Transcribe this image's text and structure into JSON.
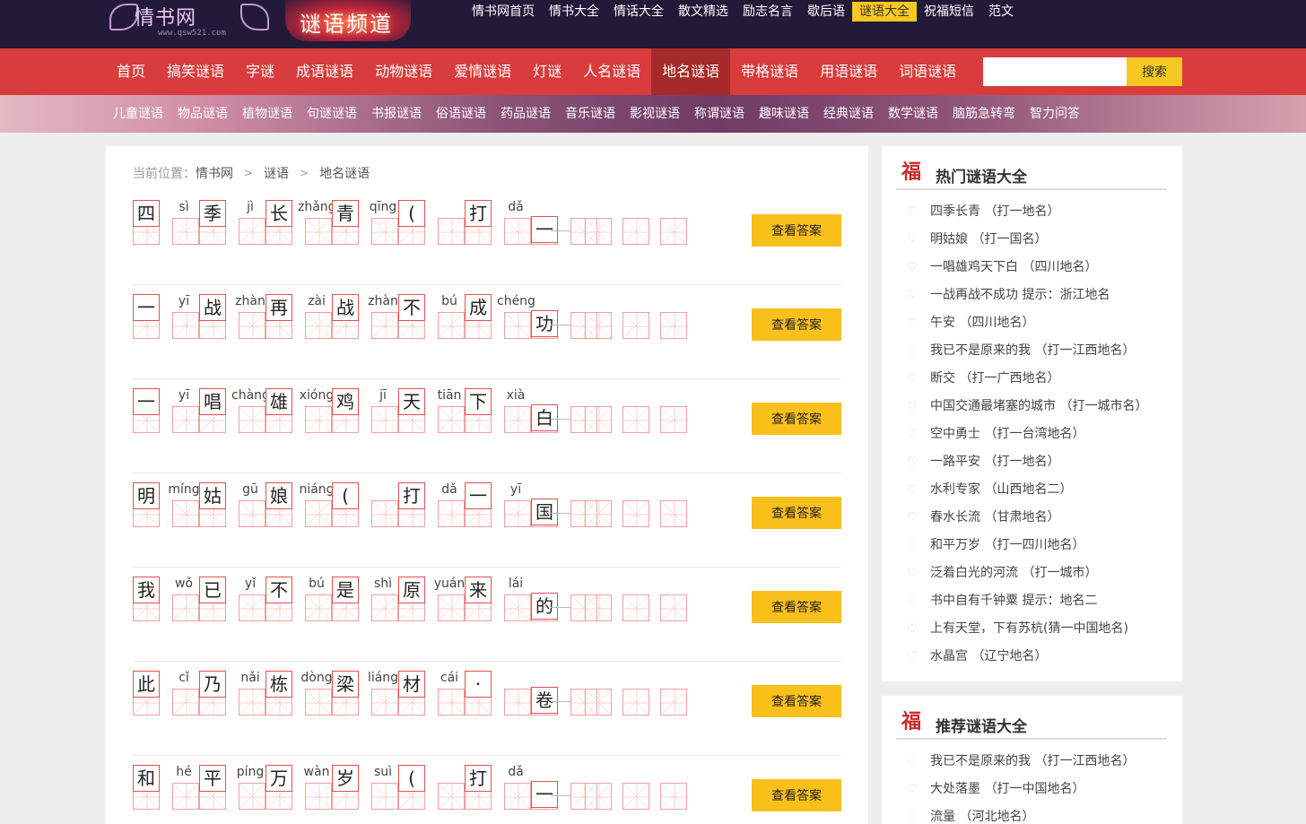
{
  "header": {
    "logo_text": "情书网",
    "logo_url": "www.qsw521.com",
    "channel": "谜语频道",
    "top_nav": [
      {
        "label": "情书网首页",
        "active": false
      },
      {
        "label": "情书大全",
        "active": false
      },
      {
        "label": "情话大全",
        "active": false
      },
      {
        "label": "散文精选",
        "active": false
      },
      {
        "label": "励志名言",
        "active": false
      },
      {
        "label": "歇后语",
        "active": false
      },
      {
        "label": "谜语大全",
        "active": true
      },
      {
        "label": "祝福短信",
        "active": false
      },
      {
        "label": "范文",
        "active": false
      }
    ]
  },
  "main_nav": [
    {
      "label": "首页",
      "active": false
    },
    {
      "label": "搞笑谜语",
      "active": false
    },
    {
      "label": "字谜",
      "active": false
    },
    {
      "label": "成语谜语",
      "active": false
    },
    {
      "label": "动物谜语",
      "active": false
    },
    {
      "label": "爱情谜语",
      "active": false
    },
    {
      "label": "灯谜",
      "active": false
    },
    {
      "label": "人名谜语",
      "active": false
    },
    {
      "label": "地名谜语",
      "active": true
    },
    {
      "label": "带格谜语",
      "active": false
    },
    {
      "label": "用语谜语",
      "active": false
    },
    {
      "label": "词语谜语",
      "active": false
    }
  ],
  "search": {
    "value": "",
    "placeholder": "",
    "button": "搜索"
  },
  "sub_nav": [
    "儿童谜语",
    "物品谜语",
    "植物谜语",
    "句谜谜语",
    "书报谜语",
    "俗语谜语",
    "药品谜语",
    "音乐谜语",
    "影视谜语",
    "称谓谜语",
    "趣味谜语",
    "经典谜语",
    "数学谜语",
    "脑筋急转弯",
    "智力问答"
  ],
  "breadcrumb": {
    "prefix": "当前位置：",
    "items": [
      "情书网",
      "谜语",
      "地名谜语"
    ]
  },
  "answer_button": "查看答案",
  "riddles": [
    {
      "chars": [
        {
          "c": "四",
          "p": "sì"
        },
        {
          "c": "季",
          "p": "jì"
        },
        {
          "c": "长",
          "p": "zhǎng"
        },
        {
          "c": "青",
          "p": "qīng"
        },
        {
          "c": "(",
          "p": ""
        },
        {
          "c": "打",
          "p": "dǎ"
        },
        {
          "c": "一",
          "p": ""
        }
      ],
      "answer_cells": 3
    },
    {
      "chars": [
        {
          "c": "一",
          "p": "yī"
        },
        {
          "c": "战",
          "p": "zhàn"
        },
        {
          "c": "再",
          "p": "zài"
        },
        {
          "c": "战",
          "p": "zhàn"
        },
        {
          "c": "不",
          "p": "bú"
        },
        {
          "c": "成",
          "p": "chéng"
        },
        {
          "c": "功",
          "p": ""
        }
      ],
      "answer_cells": 3
    },
    {
      "chars": [
        {
          "c": "一",
          "p": "yī"
        },
        {
          "c": "唱",
          "p": "chàng"
        },
        {
          "c": "雄",
          "p": "xióng"
        },
        {
          "c": "鸡",
          "p": "jī"
        },
        {
          "c": "天",
          "p": "tiān"
        },
        {
          "c": "下",
          "p": "xià"
        },
        {
          "c": "白",
          "p": ""
        }
      ],
      "answer_cells": 3
    },
    {
      "chars": [
        {
          "c": "明",
          "p": "míng"
        },
        {
          "c": "姑",
          "p": "gū"
        },
        {
          "c": "娘",
          "p": "niáng"
        },
        {
          "c": "(",
          "p": ""
        },
        {
          "c": "打",
          "p": "dǎ"
        },
        {
          "c": "一",
          "p": "yī"
        },
        {
          "c": "国",
          "p": ""
        }
      ],
      "answer_cells": 3
    },
    {
      "chars": [
        {
          "c": "我",
          "p": "wǒ"
        },
        {
          "c": "已",
          "p": "yǐ"
        },
        {
          "c": "不",
          "p": "bú"
        },
        {
          "c": "是",
          "p": "shì"
        },
        {
          "c": "原",
          "p": "yuán"
        },
        {
          "c": "来",
          "p": "lái"
        },
        {
          "c": "的",
          "p": ""
        }
      ],
      "answer_cells": 3
    },
    {
      "chars": [
        {
          "c": "此",
          "p": "cǐ"
        },
        {
          "c": "乃",
          "p": "nǎi"
        },
        {
          "c": "栋",
          "p": "dòng"
        },
        {
          "c": "梁",
          "p": "liáng"
        },
        {
          "c": "材",
          "p": "cái"
        },
        {
          "c": "·",
          "p": ""
        },
        {
          "c": "卷",
          "p": ""
        }
      ],
      "answer_cells": 3
    },
    {
      "chars": [
        {
          "c": "和",
          "p": "hé"
        },
        {
          "c": "平",
          "p": "píng"
        },
        {
          "c": "万",
          "p": "wàn"
        },
        {
          "c": "岁",
          "p": "suì"
        },
        {
          "c": "(",
          "p": ""
        },
        {
          "c": "打",
          "p": "dǎ"
        },
        {
          "c": "一",
          "p": ""
        }
      ],
      "answer_cells": 3
    }
  ],
  "sidebar": {
    "hot": {
      "icon": "福",
      "title": "热门谜语大全",
      "items": [
        "四季长青 （打一地名）",
        "明姑娘 （打一国名）",
        "一唱雄鸡天下白 （四川地名）",
        "一战再战不成功 提示：浙江地名",
        "午安 （四川地名）",
        "我已不是原来的我 （打一江西地名）",
        "断交 （打一广西地名）",
        "中国交通最堵塞的城市 （打一城市名）",
        "空中勇士 （打一台湾地名）",
        "一路平安 （打一地名）",
        "水利专家 （山西地名二）",
        "春水长流 （甘肃地名）",
        "和平万岁 （打一四川地名）",
        "泛着白光的河流 （打一城市）",
        "书中自有千钟粟 提示：地名二",
        "上有天堂，下有苏杭(猜一中国地名)",
        "水晶宫 （辽宁地名）"
      ]
    },
    "recommend": {
      "icon": "福",
      "title": "推荐谜语大全",
      "items": [
        "我已不是原来的我 （打一江西地名）",
        "大处落墨 （打一中国地名）",
        "流量 （河北地名）"
      ]
    }
  }
}
